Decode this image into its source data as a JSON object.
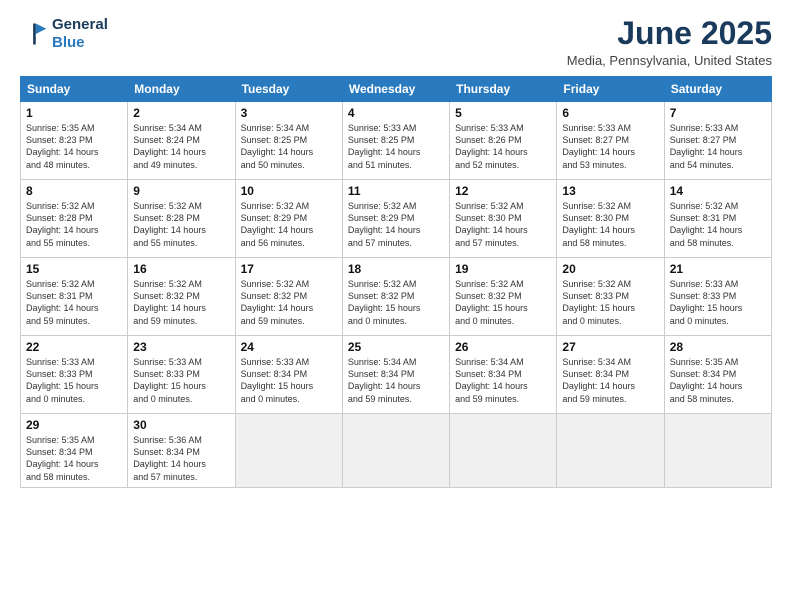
{
  "logo": {
    "line1": "General",
    "line2": "Blue"
  },
  "title": "June 2025",
  "subtitle": "Media, Pennsylvania, United States",
  "headers": [
    "Sunday",
    "Monday",
    "Tuesday",
    "Wednesday",
    "Thursday",
    "Friday",
    "Saturday"
  ],
  "weeks": [
    [
      {
        "day": "1",
        "info": "Sunrise: 5:35 AM\nSunset: 8:23 PM\nDaylight: 14 hours\nand 48 minutes."
      },
      {
        "day": "2",
        "info": "Sunrise: 5:34 AM\nSunset: 8:24 PM\nDaylight: 14 hours\nand 49 minutes."
      },
      {
        "day": "3",
        "info": "Sunrise: 5:34 AM\nSunset: 8:25 PM\nDaylight: 14 hours\nand 50 minutes."
      },
      {
        "day": "4",
        "info": "Sunrise: 5:33 AM\nSunset: 8:25 PM\nDaylight: 14 hours\nand 51 minutes."
      },
      {
        "day": "5",
        "info": "Sunrise: 5:33 AM\nSunset: 8:26 PM\nDaylight: 14 hours\nand 52 minutes."
      },
      {
        "day": "6",
        "info": "Sunrise: 5:33 AM\nSunset: 8:27 PM\nDaylight: 14 hours\nand 53 minutes."
      },
      {
        "day": "7",
        "info": "Sunrise: 5:33 AM\nSunset: 8:27 PM\nDaylight: 14 hours\nand 54 minutes."
      }
    ],
    [
      {
        "day": "8",
        "info": "Sunrise: 5:32 AM\nSunset: 8:28 PM\nDaylight: 14 hours\nand 55 minutes."
      },
      {
        "day": "9",
        "info": "Sunrise: 5:32 AM\nSunset: 8:28 PM\nDaylight: 14 hours\nand 55 minutes."
      },
      {
        "day": "10",
        "info": "Sunrise: 5:32 AM\nSunset: 8:29 PM\nDaylight: 14 hours\nand 56 minutes."
      },
      {
        "day": "11",
        "info": "Sunrise: 5:32 AM\nSunset: 8:29 PM\nDaylight: 14 hours\nand 57 minutes."
      },
      {
        "day": "12",
        "info": "Sunrise: 5:32 AM\nSunset: 8:30 PM\nDaylight: 14 hours\nand 57 minutes."
      },
      {
        "day": "13",
        "info": "Sunrise: 5:32 AM\nSunset: 8:30 PM\nDaylight: 14 hours\nand 58 minutes."
      },
      {
        "day": "14",
        "info": "Sunrise: 5:32 AM\nSunset: 8:31 PM\nDaylight: 14 hours\nand 58 minutes."
      }
    ],
    [
      {
        "day": "15",
        "info": "Sunrise: 5:32 AM\nSunset: 8:31 PM\nDaylight: 14 hours\nand 59 minutes."
      },
      {
        "day": "16",
        "info": "Sunrise: 5:32 AM\nSunset: 8:32 PM\nDaylight: 14 hours\nand 59 minutes."
      },
      {
        "day": "17",
        "info": "Sunrise: 5:32 AM\nSunset: 8:32 PM\nDaylight: 14 hours\nand 59 minutes."
      },
      {
        "day": "18",
        "info": "Sunrise: 5:32 AM\nSunset: 8:32 PM\nDaylight: 15 hours\nand 0 minutes."
      },
      {
        "day": "19",
        "info": "Sunrise: 5:32 AM\nSunset: 8:32 PM\nDaylight: 15 hours\nand 0 minutes."
      },
      {
        "day": "20",
        "info": "Sunrise: 5:32 AM\nSunset: 8:33 PM\nDaylight: 15 hours\nand 0 minutes."
      },
      {
        "day": "21",
        "info": "Sunrise: 5:33 AM\nSunset: 8:33 PM\nDaylight: 15 hours\nand 0 minutes."
      }
    ],
    [
      {
        "day": "22",
        "info": "Sunrise: 5:33 AM\nSunset: 8:33 PM\nDaylight: 15 hours\nand 0 minutes."
      },
      {
        "day": "23",
        "info": "Sunrise: 5:33 AM\nSunset: 8:33 PM\nDaylight: 15 hours\nand 0 minutes."
      },
      {
        "day": "24",
        "info": "Sunrise: 5:33 AM\nSunset: 8:34 PM\nDaylight: 15 hours\nand 0 minutes."
      },
      {
        "day": "25",
        "info": "Sunrise: 5:34 AM\nSunset: 8:34 PM\nDaylight: 14 hours\nand 59 minutes."
      },
      {
        "day": "26",
        "info": "Sunrise: 5:34 AM\nSunset: 8:34 PM\nDaylight: 14 hours\nand 59 minutes."
      },
      {
        "day": "27",
        "info": "Sunrise: 5:34 AM\nSunset: 8:34 PM\nDaylight: 14 hours\nand 59 minutes."
      },
      {
        "day": "28",
        "info": "Sunrise: 5:35 AM\nSunset: 8:34 PM\nDaylight: 14 hours\nand 58 minutes."
      }
    ],
    [
      {
        "day": "29",
        "info": "Sunrise: 5:35 AM\nSunset: 8:34 PM\nDaylight: 14 hours\nand 58 minutes."
      },
      {
        "day": "30",
        "info": "Sunrise: 5:36 AM\nSunset: 8:34 PM\nDaylight: 14 hours\nand 57 minutes."
      },
      null,
      null,
      null,
      null,
      null
    ]
  ]
}
